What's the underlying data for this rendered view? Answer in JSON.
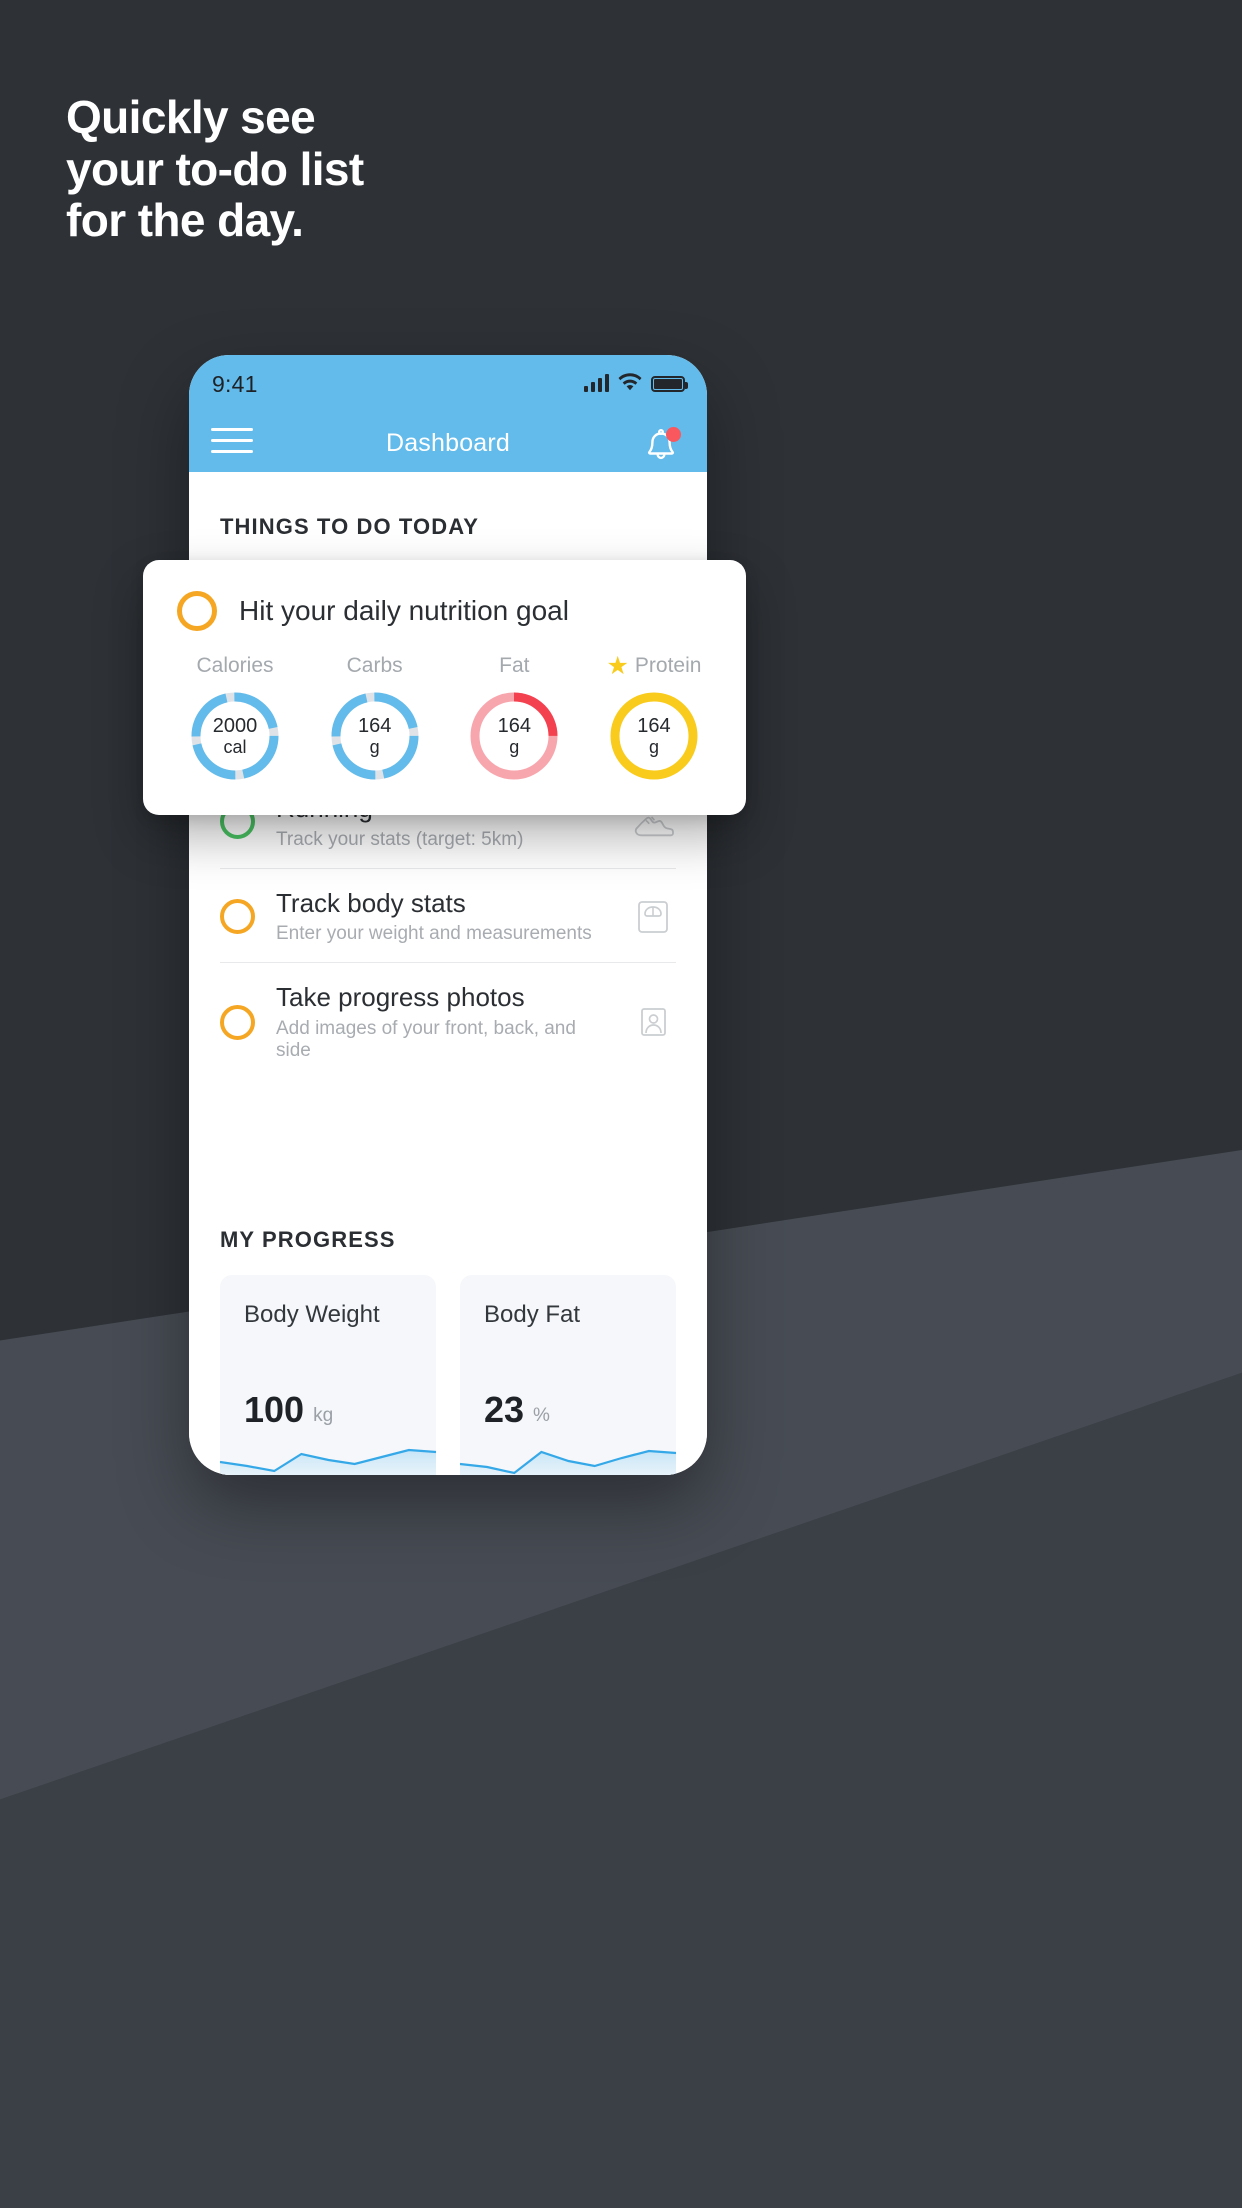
{
  "headline": "Quickly see\nyour to-do list\nfor the day.",
  "colors": {
    "background": "#2e3237",
    "accent_blue": "#63bbeb",
    "accent_yellow": "#f5a623",
    "accent_green": "#49c463",
    "accent_red": "#f4606a",
    "protein_yellow": "#f9cb1c",
    "notification_red": "#f9585e"
  },
  "phone": {
    "status_bar": {
      "time": "9:41",
      "icons": [
        "signal-bars-icon",
        "wifi-icon",
        "battery-icon"
      ]
    },
    "app_bar": {
      "menu_icon": "hamburger-menu-icon",
      "title": "Dashboard",
      "notification_icon": "bell-icon",
      "has_badge": true
    },
    "sections": {
      "todo_heading": "THINGS TO DO TODAY",
      "progress_heading": "MY PROGRESS"
    },
    "todo_items": [
      {
        "title": "Running",
        "subtitle": "Track your stats (target: 5km)",
        "ring_color": "green",
        "icon": "running-shoe-icon"
      },
      {
        "title": "Track body stats",
        "subtitle": "Enter your weight and measurements",
        "ring_color": "yellow",
        "icon": "weight-scale-icon"
      },
      {
        "title": "Take progress photos",
        "subtitle": "Add images of your front, back, and side",
        "ring_color": "yellow",
        "icon": "person-photo-icon"
      }
    ],
    "progress_cards": [
      {
        "label": "Body Weight",
        "value": "100",
        "unit": "kg"
      },
      {
        "label": "Body Fat",
        "value": "23",
        "unit": "%"
      }
    ]
  },
  "nutrition_card": {
    "ring_icon": "checkbox-ring-icon",
    "title": "Hit your daily nutrition goal",
    "macros": [
      {
        "label": "Calories",
        "value": "2000",
        "unit": "cal",
        "starred": false,
        "color": "#63bbeb",
        "track": "#dfe3e7",
        "percent": 100,
        "style": "segmented"
      },
      {
        "label": "Carbs",
        "value": "164",
        "unit": "g",
        "starred": false,
        "color": "#63bbeb",
        "track": "#dfe3e7",
        "percent": 100,
        "style": "segmented"
      },
      {
        "label": "Fat",
        "value": "164",
        "unit": "g",
        "starred": true,
        "color": "#f4606a",
        "track": "#f8a6ad",
        "percent": 25,
        "style": "arc"
      },
      {
        "label": "Protein",
        "value": "164",
        "unit": "g",
        "starred": true,
        "color": "#f9cb1c",
        "track": "#f9cb1c",
        "percent": 100,
        "style": "full"
      }
    ],
    "star_glyph": "★"
  },
  "chart_data": {
    "type": "line",
    "title": "MY PROGRESS",
    "series": [
      {
        "name": "Body Weight",
        "unit": "kg",
        "current": 100,
        "values": [
          50,
          40,
          30,
          62,
          52,
          44,
          58,
          70,
          66
        ]
      },
      {
        "name": "Body Fat",
        "unit": "%",
        "current": 23,
        "values": [
          48,
          42,
          28,
          60,
          50,
          38,
          52,
          68,
          64
        ]
      }
    ],
    "xlabel": "",
    "ylabel": "",
    "grid": false,
    "legend": "none"
  }
}
